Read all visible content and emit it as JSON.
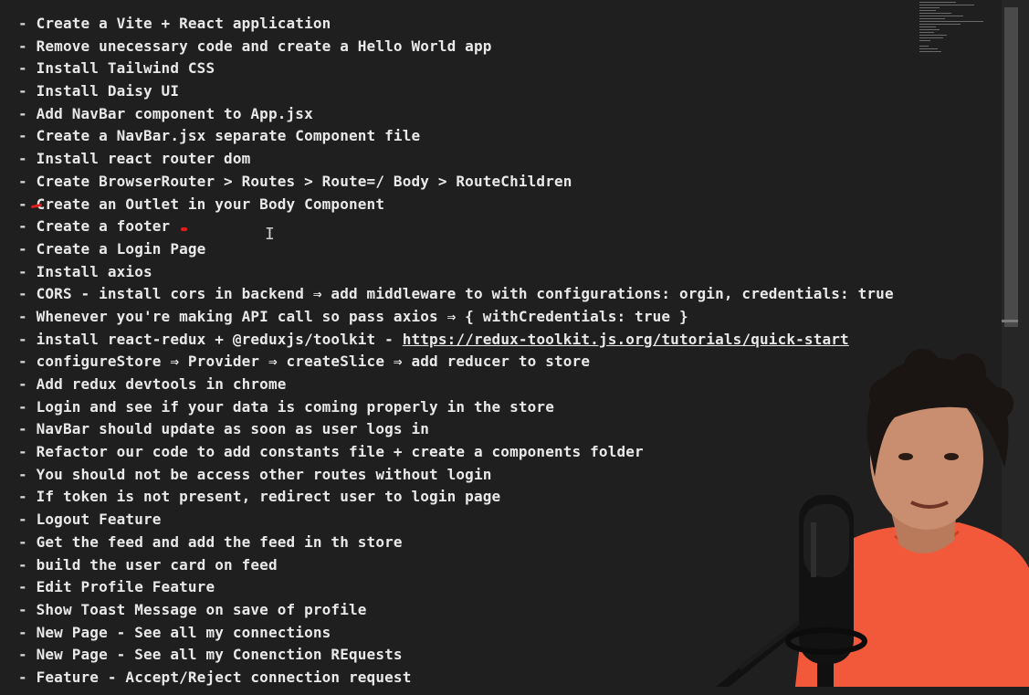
{
  "editor": {
    "lines": [
      {
        "dash": "-",
        "text": "Create a Vite + React application"
      },
      {
        "dash": "-",
        "text": "Remove unecessary code and create a Hello World app"
      },
      {
        "dash": "-",
        "text": "Install Tailwind CSS"
      },
      {
        "dash": "-",
        "text": "Install Daisy UI"
      },
      {
        "dash": "-",
        "text": "Add NavBar component to App.jsx"
      },
      {
        "dash": "-",
        "text": "Create a NavBar.jsx separate Component file"
      },
      {
        "dash": "-",
        "text": "Install react router dom"
      },
      {
        "dash": "-",
        "text": "Create BrowserRouter > Routes > Route=/ Body > RouteChildren"
      },
      {
        "dash": "-",
        "text": "Create an Outlet in your Body Component"
      },
      {
        "dash": "-",
        "text": "Create a footer"
      },
      {
        "dash": "-",
        "text": "Create a Login Page"
      },
      {
        "dash": "-",
        "text": "Install axios"
      },
      {
        "dash": "-",
        "text": "CORS - install cors in backend ⇒ add middleware to with configurations: orgin, credentials: true"
      },
      {
        "dash": "-",
        "text": "Whenever you're making API call so pass axios ⇒ { withCredentials: true }"
      },
      {
        "dash": "-",
        "text": "install react-redux + @reduxjs/toolkit - ",
        "link": "https://redux-toolkit.js.org/tutorials/quick-start"
      },
      {
        "dash": "-",
        "text": "configureStore ⇒ Provider ⇒ createSlice ⇒ add reducer to store"
      },
      {
        "dash": "-",
        "text": "Add redux devtools in chrome"
      },
      {
        "dash": "-",
        "text": "Login and see if your data is coming properly in the store"
      },
      {
        "dash": "-",
        "text": "NavBar should update as soon as user logs in"
      },
      {
        "dash": "-",
        "text": "Refactor our code to add constants file + create a components folder"
      },
      {
        "dash": "-",
        "text": "You should not be access other routes without login"
      },
      {
        "dash": "-",
        "text": "If token is not present, redirect user to login page"
      },
      {
        "dash": "-",
        "text": "Logout Feature"
      },
      {
        "dash": "-",
        "text": "Get the feed and add the feed in th store"
      },
      {
        "dash": "-",
        "text": "build the user card on feed"
      },
      {
        "dash": "-",
        "text": "Edit Profile Feature"
      },
      {
        "dash": "-",
        "text": "Show Toast Message on save of profile"
      },
      {
        "dash": "-",
        "text": "New Page - See all my connections"
      },
      {
        "dash": "-",
        "text": "New Page - See all my Conenction REquests"
      },
      {
        "dash": "-",
        "text": "Feature - Accept/Reject connection request"
      }
    ],
    "cursor_glyph": "I"
  },
  "colors": {
    "background": "#1f1f1f",
    "text": "#e9e9e9",
    "annotation_red": "#e21b1b",
    "shirt": "#f2593b",
    "microphone": "#121212"
  },
  "icons": {
    "cursor": "text-cursor-icon"
  }
}
